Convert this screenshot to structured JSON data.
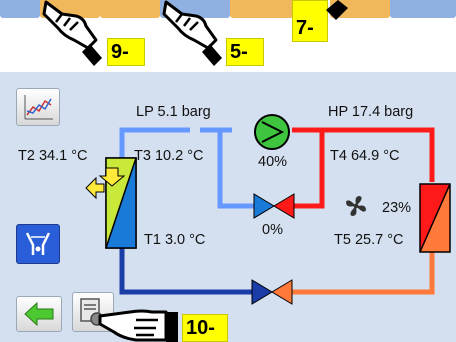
{
  "callouts": {
    "c9": "9-",
    "c5": "5-",
    "c7": "7-",
    "c10": "10-"
  },
  "readings": {
    "lp": "LP 5.1 barg",
    "hp": "HP  17.4 barg",
    "t2": "T2 34.1 °C",
    "t3": "T3 10.2 °C",
    "t4": "T4  64.9 °C",
    "t1": "T1 3.0 °C",
    "t5": "T5  25.7 °C",
    "compressor_pct": "40%",
    "valve_pct": "0%",
    "fan_pct": "23%"
  },
  "icons": {
    "chart": "trend-chart-icon",
    "buffer": "tank-valve-icon",
    "back": "green-back-arrow-icon",
    "settings": "document-settings-icon",
    "hand": "pointing-hand-icon"
  },
  "colors": {
    "panel_bg": "#d4e0ef",
    "hot_pipe": "#ff1a1a",
    "cold_pipe": "#6699ff",
    "liquid_pipe": "#1a3da8",
    "warm_pipe": "#ff7a3a",
    "compressor": "#3fc43f",
    "callout": "#ffff00"
  },
  "levels": {
    "compressor": 0.4,
    "expansion_valve": 0.0,
    "fan": 0.23
  }
}
